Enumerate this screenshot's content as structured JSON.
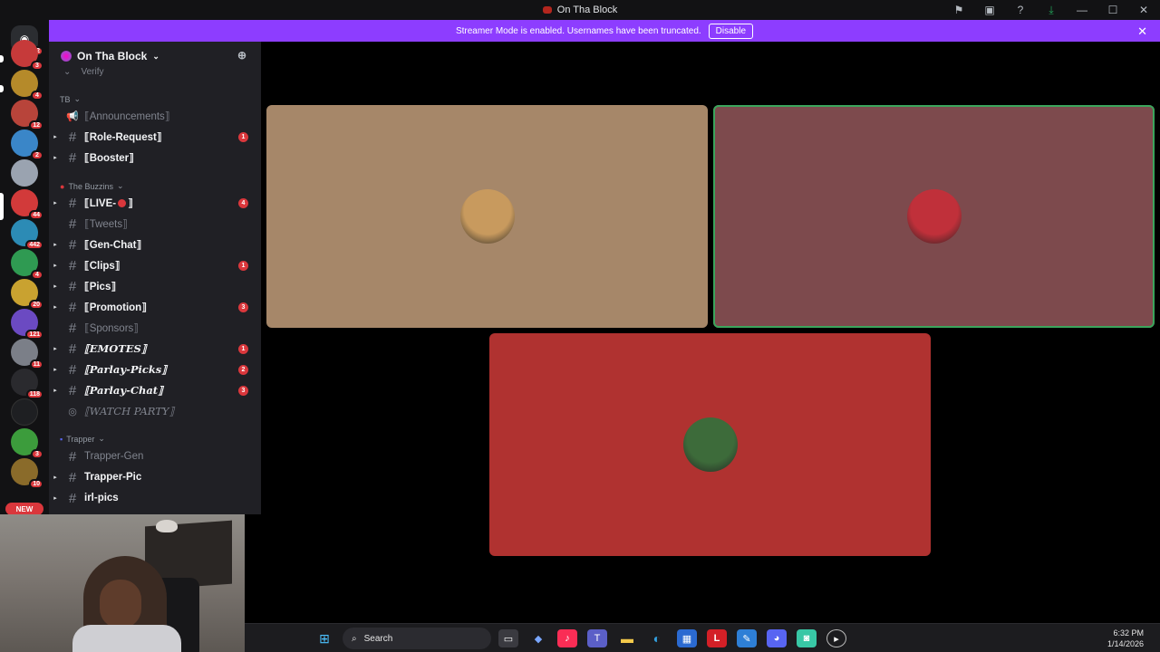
{
  "window": {
    "title": "On Tha Block"
  },
  "banner": {
    "message": "Streamer Mode is enabled. Usernames have been truncated.",
    "button": "Disable"
  },
  "guilds": {
    "dm_badge": "32",
    "badges": [
      "3",
      "4",
      "12",
      "2",
      "",
      "44",
      "442",
      "4",
      "20",
      "121",
      "11",
      "118",
      "",
      "3",
      "10"
    ],
    "new_label": "NEW"
  },
  "server": {
    "name": "On Tha Block",
    "peek_channel": "Verify"
  },
  "categories": {
    "tb": "TB",
    "buzzins": "The Buzzins",
    "trapper": "Trapper"
  },
  "channels": [
    {
      "name": "⟦Announcements⟧",
      "count": ""
    },
    {
      "name": "⟦Role-Request⟧",
      "count": "1"
    },
    {
      "name": "⟦Booster⟧",
      "count": ""
    },
    {
      "name_left": "⟦LIVE-",
      "name_right": "⟧",
      "count": "4"
    },
    {
      "name": "⟦Tweets⟧",
      "count": ""
    },
    {
      "name": "⟦Gen-Chat⟧",
      "count": ""
    },
    {
      "name": "⟦Clips⟧",
      "count": "1"
    },
    {
      "name": "⟦Pics⟧",
      "count": ""
    },
    {
      "name": "⟦Promotion⟧",
      "count": "3"
    },
    {
      "name": "⟦Sponsors⟧",
      "count": ""
    },
    {
      "name": "⟦EMOTES⟧",
      "count": "1"
    },
    {
      "name": "⟦Parlay-Picks⟧",
      "count": "2"
    },
    {
      "name": "⟦Parlay-Chat⟧",
      "count": "3"
    },
    {
      "name": "⟦WATCH PARTY⟧",
      "count": ""
    },
    {
      "name": "Trapper-Gen",
      "count": ""
    },
    {
      "name": "Trapper-Pic",
      "count": ""
    },
    {
      "name": "irl-pics",
      "count": ""
    }
  ],
  "voice_tiles": [
    {
      "color": "#a68769",
      "avatar": "#c89a5e"
    },
    {
      "color": "#7d4a4d",
      "avatar": "#c0303a"
    },
    {
      "color": "#b03230",
      "avatar": "#3d6b3a"
    }
  ],
  "taskbar": {
    "search_placeholder": "Search",
    "time": "6:32 PM",
    "date": "1/14/2026"
  },
  "colors": {
    "accent_banner": "#8d3dff",
    "badge_red": "#da373c",
    "speaking_green": "#3ba55c"
  }
}
